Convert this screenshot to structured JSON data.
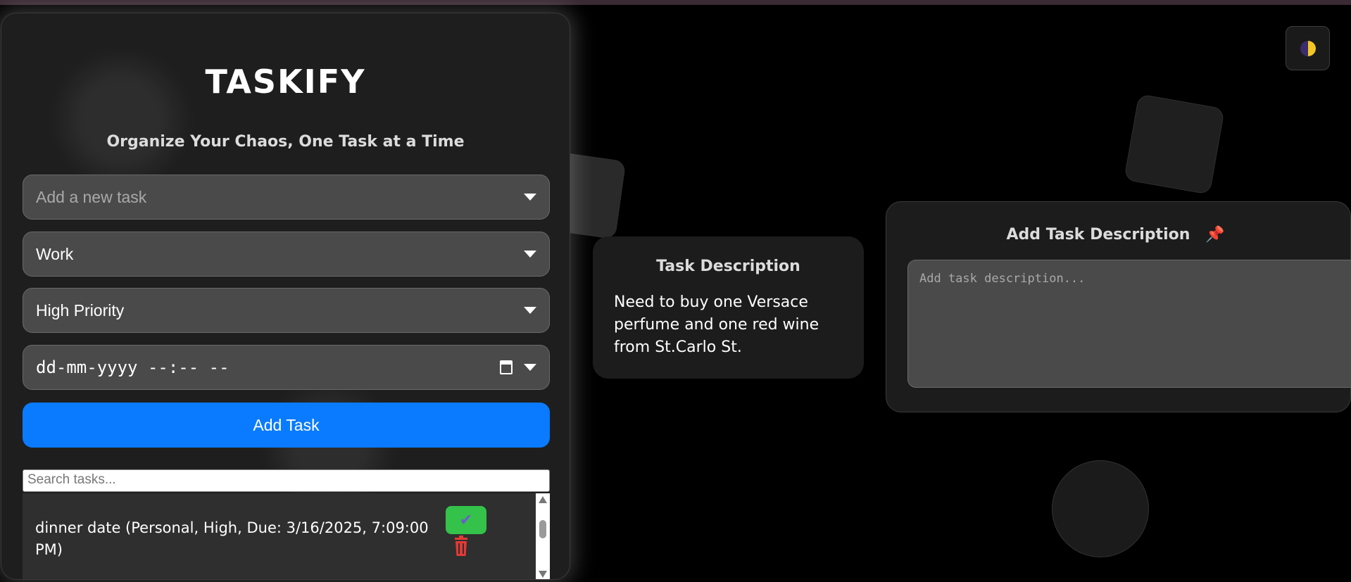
{
  "app": {
    "title": "TASKIFY",
    "subtitle": "Organize Your Chaos, One Task at a Time"
  },
  "form": {
    "task_placeholder": "Add a new task",
    "category_value": "Work",
    "priority_value": "High Priority",
    "datetime_placeholder": "dd-mm-yyyy --:-- --",
    "add_button_label": "Add Task",
    "search_placeholder": "Search tasks..."
  },
  "tasks": [
    {
      "text": "dinner date (Personal, High, Due: 3/16/2025, 7:09:00 PM)",
      "complete_icon": "check-icon",
      "delete_icon": "trash-icon"
    }
  ],
  "description_panel": {
    "title": "Task Description",
    "body": "Need to buy one Versace perfume and one red wine from St.Carlo St."
  },
  "add_description": {
    "title": "Add Task Description",
    "icon": "pushpin-icon",
    "placeholder": "Add task description..."
  },
  "theme_toggle": {
    "icon": "theme-toggle-icon"
  },
  "colors": {
    "accent": "#0a7bff",
    "complete": "#34c24a",
    "delete": "#e53935",
    "background": "#000000"
  }
}
